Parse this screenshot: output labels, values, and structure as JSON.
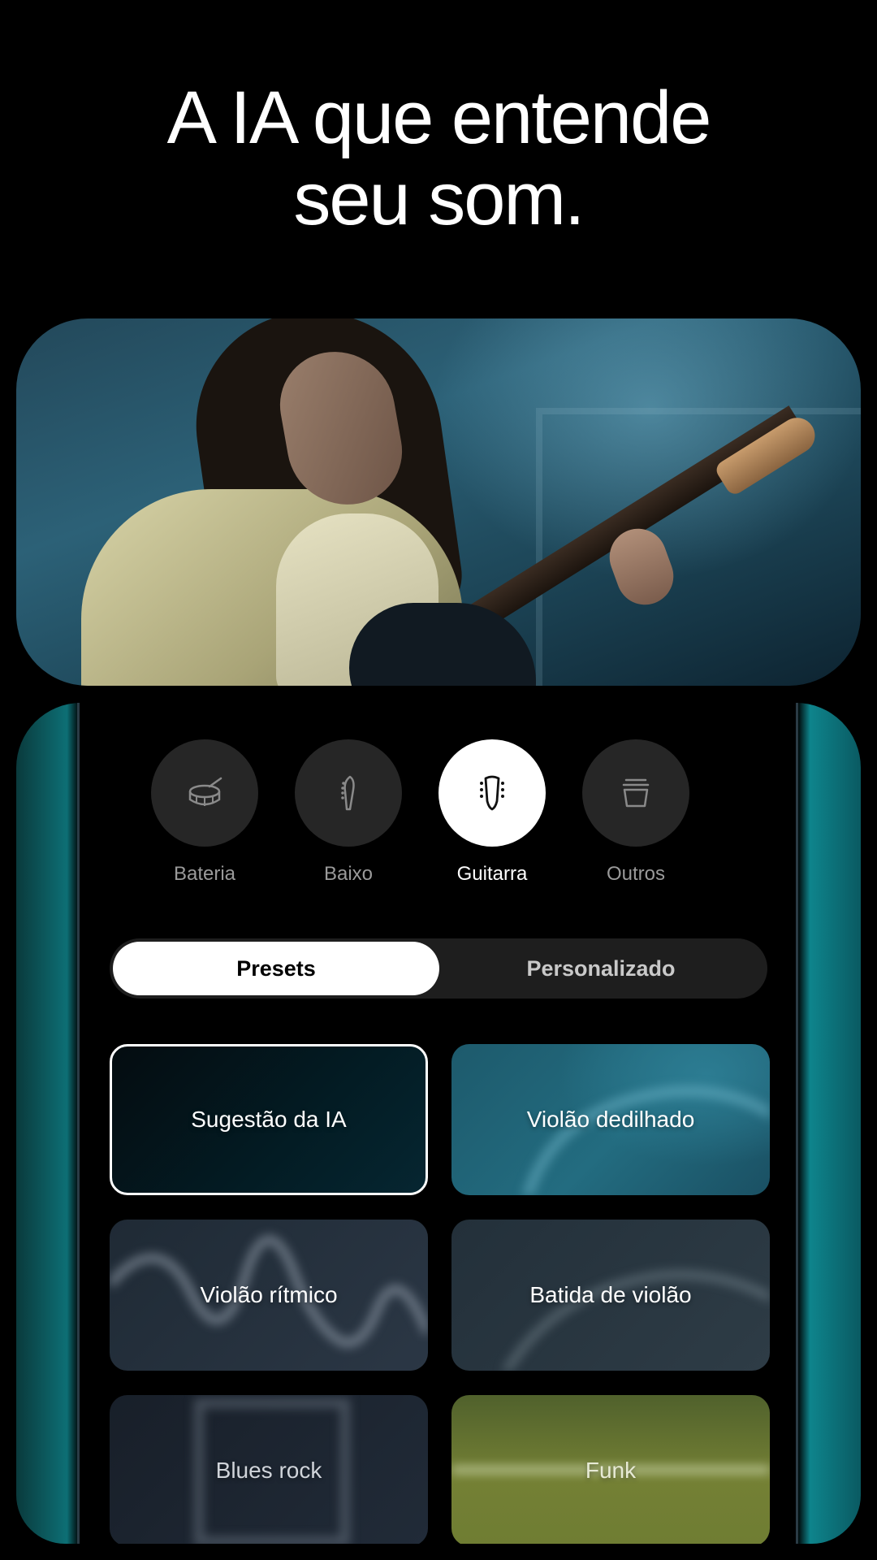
{
  "headline": {
    "line1": "A IA que entende",
    "line2": "seu som."
  },
  "instruments": [
    {
      "label": "Bateria",
      "icon": "drum-icon",
      "active": false
    },
    {
      "label": "Baixo",
      "icon": "bass-headstock-icon",
      "active": false
    },
    {
      "label": "Guitarra",
      "icon": "guitar-headstock-icon",
      "active": true
    },
    {
      "label": "Outros",
      "icon": "bucket-icon",
      "active": false
    }
  ],
  "segmented": {
    "left": "Presets",
    "right": "Personalizado",
    "selected": "Presets"
  },
  "presets": [
    {
      "label": "Sugestão da IA",
      "selected": true
    },
    {
      "label": "Violão dedilhado",
      "selected": false
    },
    {
      "label": "Violão rítmico",
      "selected": false
    },
    {
      "label": "Batida de violão",
      "selected": false
    },
    {
      "label": "Blues rock",
      "selected": false
    },
    {
      "label": "Funk",
      "selected": false
    }
  ],
  "colors": {
    "accent_teal": "#0e848c",
    "tile_dedilhado": "#236c80",
    "tile_funk": "#748034"
  }
}
